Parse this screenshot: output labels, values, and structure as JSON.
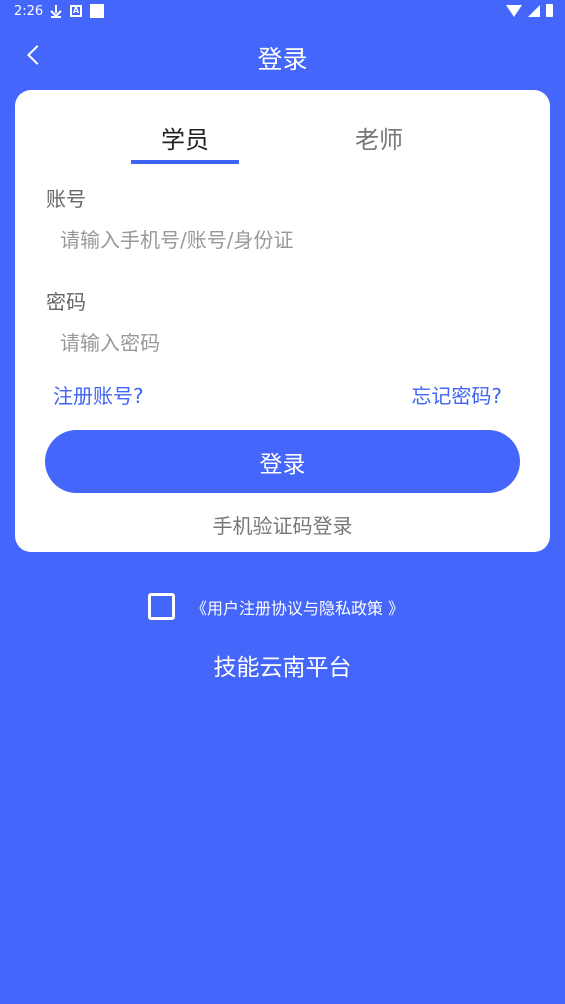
{
  "status_bar": {
    "time": "2:26",
    "icons": [
      "download-icon",
      "a-icon",
      "square-icon",
      "wifi-icon",
      "signal-icon",
      "battery-icon"
    ]
  },
  "header": {
    "title": "登录",
    "back_icon": "chevron-left-icon"
  },
  "tabs": {
    "student": "学员",
    "teacher": "老师",
    "active": "student"
  },
  "form": {
    "account_label": "账号",
    "account_value": "",
    "account_placeholder": "请输入手机号/账号/身份证",
    "password_label": "密码",
    "password_value": "",
    "password_placeholder": "请输入密码"
  },
  "links": {
    "register": "注册账号?",
    "forgot": "忘记密码?"
  },
  "buttons": {
    "login": "登录",
    "sms_login": "手机验证码登录"
  },
  "agreement": {
    "checked": false,
    "text": "《用户注册协议与隐私政策 》"
  },
  "footer": {
    "platform_name": "技能云南平台"
  },
  "colors": {
    "brand_blue": "#4466fb",
    "accent_blue": "#3f64f5",
    "card_white": "#ffffff"
  }
}
